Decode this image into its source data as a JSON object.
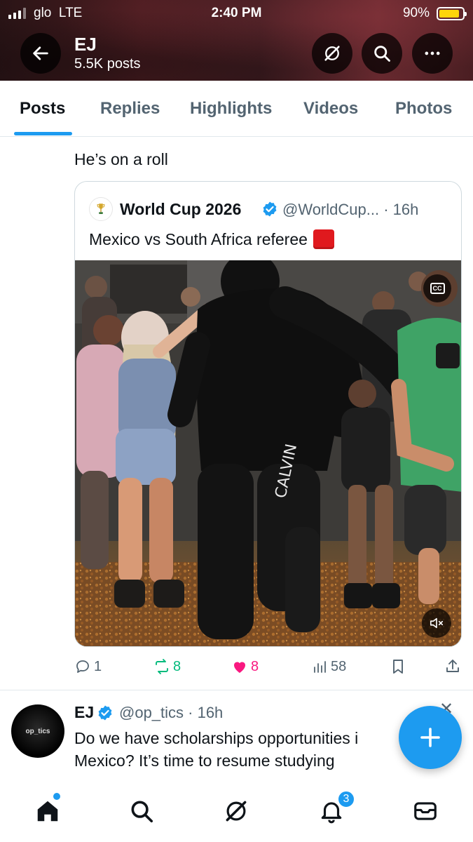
{
  "status_bar": {
    "carrier": "glo",
    "network": "LTE",
    "time": "2:40 PM",
    "battery": "90%",
    "battery_level": 0.9
  },
  "header": {
    "name": "EJ",
    "posts_count": "5.5K posts",
    "icons": [
      "back-arrow-icon",
      "grok-icon",
      "search-icon",
      "more-icon"
    ]
  },
  "tabs": [
    "Posts",
    "Replies",
    "Highlights",
    "Videos",
    "Photos"
  ],
  "active_tab": "Posts",
  "post": {
    "text": "He’s on a roll",
    "quote": {
      "name": "World Cup 2026",
      "handle_time": "@WorldCup... · 16h",
      "text": "Mexico vs South Africa referee",
      "media": "video"
    },
    "stats": {
      "replies": "1",
      "reposts": "8",
      "likes": "8",
      "views": "58"
    }
  },
  "post2": {
    "avatar_text": "op_tics",
    "name": "EJ",
    "handle_time": "@op_tics · 16h",
    "text_line1": "Do we have scholarships opportunities i",
    "text_line2": "Mexico? It’s time to resume studying"
  },
  "bottom_nav": {
    "items": [
      "home-icon",
      "search-icon",
      "grok-icon",
      "notifications-icon",
      "messages-icon"
    ],
    "notifications_badge": "3"
  },
  "colors": {
    "accent": "#1d9bf0",
    "like": "#f91880",
    "repost": "#00ba7c",
    "red_card": "#e0191e"
  }
}
